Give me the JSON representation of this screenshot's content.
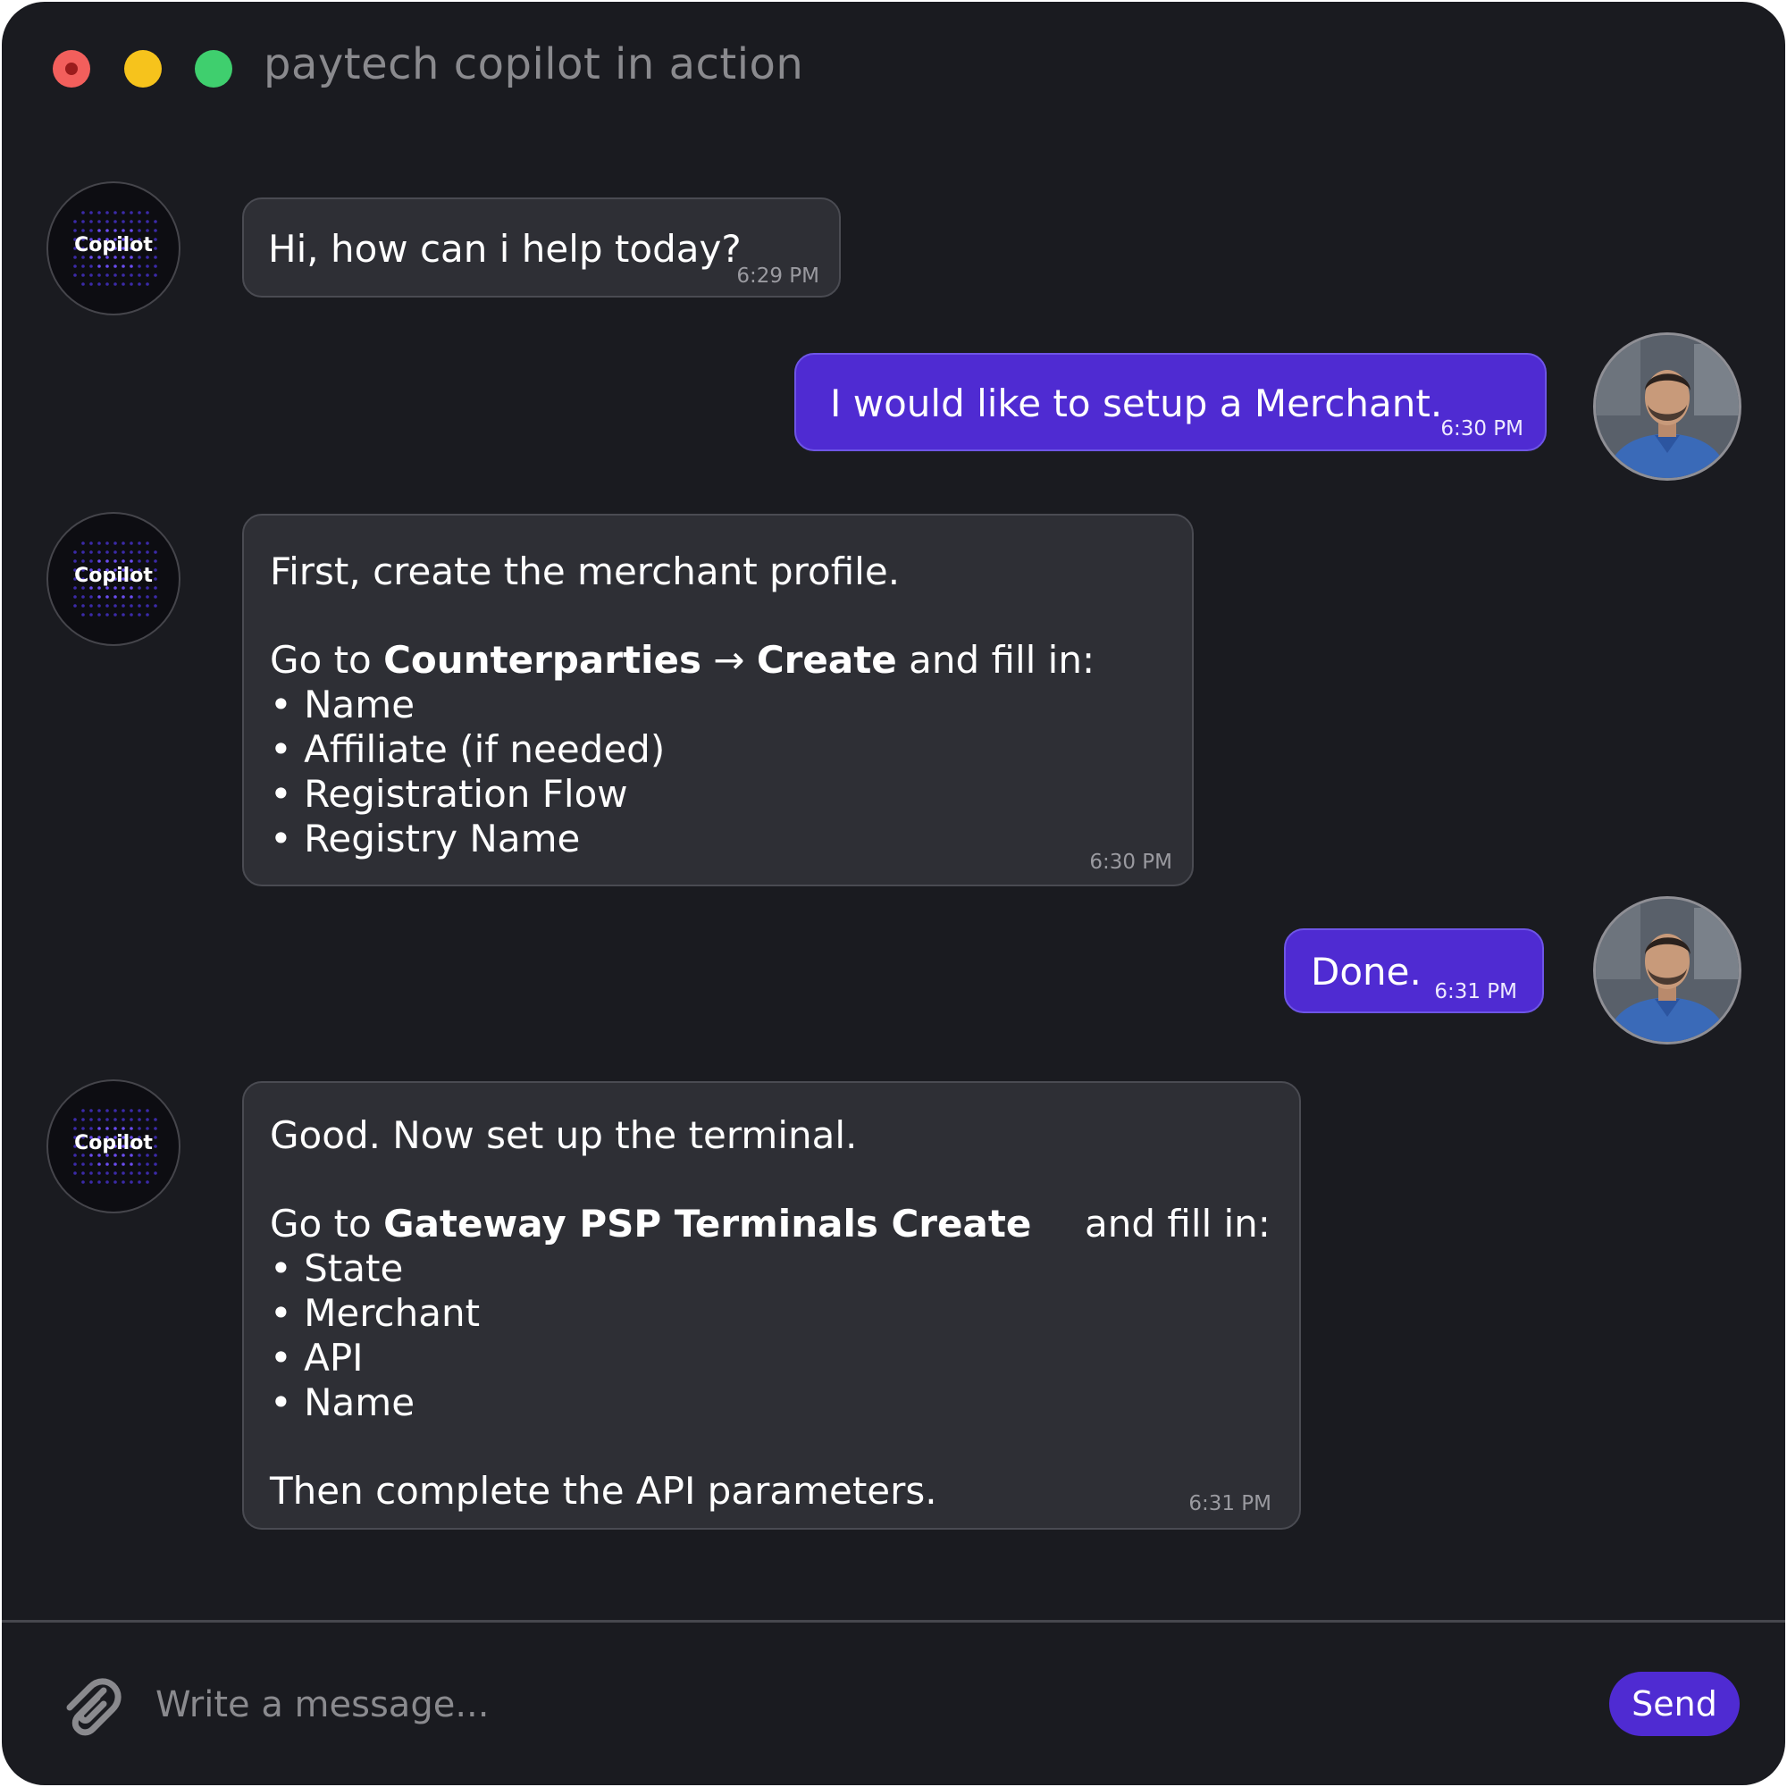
{
  "window": {
    "title": "paytech copilot in action",
    "traffic_lights": [
      "close",
      "minimize",
      "zoom"
    ]
  },
  "colors": {
    "background": "#1a1b20",
    "bot_bubble": "#2e2f35",
    "user_bubble": "#4f2bd2",
    "accent": "#4f2bd2",
    "close": "#f25f5c",
    "minimize": "#f6c31c",
    "zoom": "#3fcf6e"
  },
  "bot": {
    "avatar_label": "Copilot"
  },
  "messages": [
    {
      "from": "bot",
      "time": "6:29 PM",
      "text": "Hi, how can i help today?"
    },
    {
      "from": "user",
      "time": "6:30 PM",
      "text": "I would like to setup a Merchant."
    },
    {
      "from": "bot",
      "time": "6:30 PM",
      "intro": "First, create the merchant profile.",
      "goto_prefix": "Go to ",
      "path_1": "Counterparties",
      "arrow": " → ",
      "path_2": "Create",
      "goto_suffix": " and fill in:",
      "items": [
        "• Name",
        "• Affiliate (if needed)",
        "• Registration Flow",
        "• Registry Name"
      ]
    },
    {
      "from": "user",
      "time": "6:31 PM",
      "text": "Done."
    },
    {
      "from": "bot",
      "time": "6:31 PM",
      "intro": "Good. Now set up the terminal.",
      "goto_prefix": "Go to ",
      "path": "Gateway PSP Terminals Create",
      "goto_suffix": "and fill in:",
      "items": [
        "• State",
        "• Merchant",
        "• API",
        "• Name"
      ],
      "outro": "Then complete the API parameters."
    }
  ],
  "composer": {
    "placeholder": "Write a message...",
    "attach_icon": "paperclip-icon",
    "send_label": "Send"
  }
}
